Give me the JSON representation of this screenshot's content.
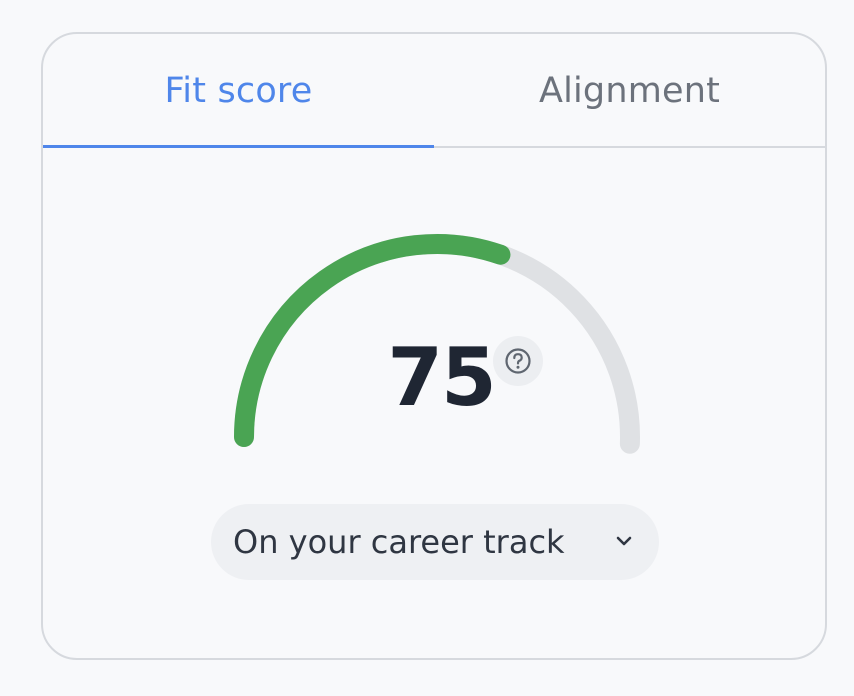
{
  "tabs": [
    {
      "label": "Fit score",
      "active": true
    },
    {
      "label": "Alignment",
      "active": false
    }
  ],
  "score": {
    "value": "75",
    "max": 100,
    "fraction": 0.75
  },
  "status": {
    "label": "On your career track"
  },
  "icons": {
    "help": "question-circle-icon",
    "dropdown": "chevron-down-icon"
  },
  "colors": {
    "accent": "#4f86ea",
    "gauge_fill": "#4aa453",
    "gauge_track": "#dfe1e4",
    "score_text": "#1f2633"
  }
}
